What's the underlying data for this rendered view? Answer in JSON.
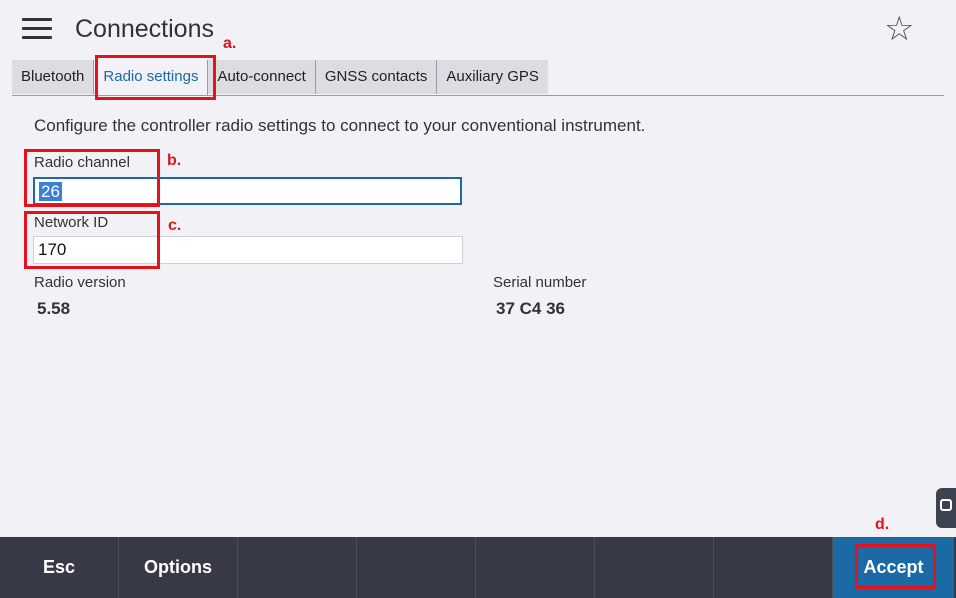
{
  "header": {
    "title": "Connections"
  },
  "tabs": [
    {
      "label": "Bluetooth"
    },
    {
      "label": "Radio settings"
    },
    {
      "label": "Auto-connect"
    },
    {
      "label": "GNSS contacts"
    },
    {
      "label": "Auxiliary GPS"
    }
  ],
  "description": "Configure the controller radio settings to connect to your conventional instrument.",
  "fields": {
    "radio_channel": {
      "label": "Radio channel",
      "value": "26"
    },
    "network_id": {
      "label": "Network ID",
      "value": "170"
    },
    "radio_version": {
      "label": "Radio version",
      "value": "5.58"
    },
    "serial_number": {
      "label": "Serial number",
      "value": "37 C4 36"
    }
  },
  "annotations": {
    "a": "a.",
    "b": "b.",
    "c": "c.",
    "d": "d."
  },
  "softkeys": {
    "esc": "Esc",
    "options": "Options",
    "accept": "Accept"
  },
  "icons": {
    "menu": "hamburger-menu-icon",
    "favorite": "star-outline-icon",
    "side": "side-panel-tab-icon"
  },
  "colors": {
    "accent": "#1b6aa6",
    "annotation": "#e3121d",
    "bottombar": "#373a46"
  }
}
